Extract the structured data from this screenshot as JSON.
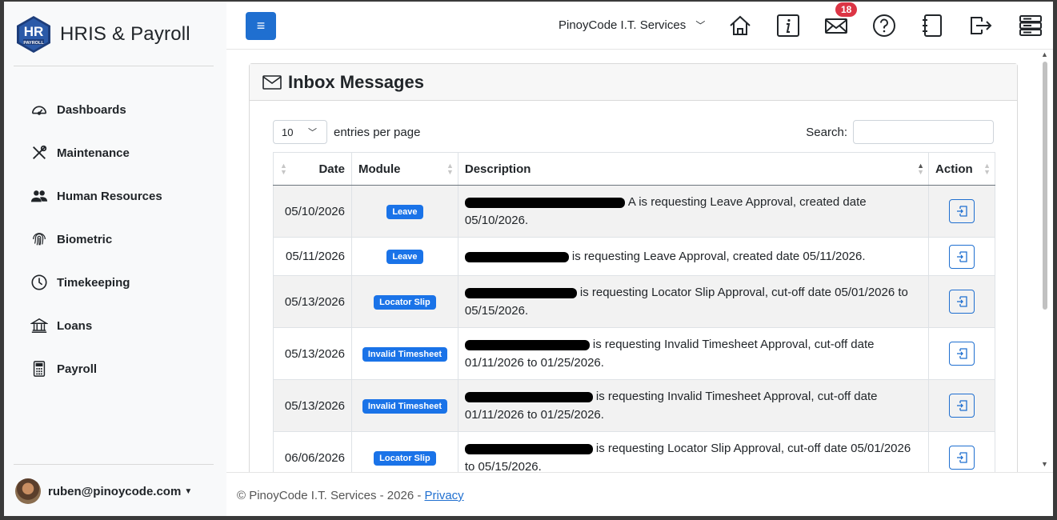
{
  "app": {
    "logo_text": "HR",
    "logo_subtext": "PAYROLL",
    "title": "HRIS & Payroll"
  },
  "sidebar": {
    "items": [
      {
        "label": "Dashboards",
        "icon": "gauge-icon"
      },
      {
        "label": "Maintenance",
        "icon": "tools-icon"
      },
      {
        "label": "Human Resources",
        "icon": "people-icon"
      },
      {
        "label": "Biometric",
        "icon": "fingerprint-icon"
      },
      {
        "label": "Timekeeping",
        "icon": "clock-icon"
      },
      {
        "label": "Loans",
        "icon": "bank-icon"
      },
      {
        "label": "Payroll",
        "icon": "calculator-icon"
      }
    ],
    "user": "ruben@pinoycode.com"
  },
  "topbar": {
    "company": "PinoyCode I.T. Services",
    "notification_count": "18"
  },
  "inbox": {
    "title": "Inbox Messages",
    "page_size": "10",
    "entries_label": "entries per page",
    "search_label": "Search:",
    "search_value": "",
    "columns": {
      "date": "Date",
      "module": "Module",
      "description": "Description",
      "action": "Action"
    },
    "rows": [
      {
        "date": "05/10/2026",
        "module": "Leave",
        "redact_width": 200,
        "text": "A is requesting Leave Approval, created date 05/10/2026."
      },
      {
        "date": "05/11/2026",
        "module": "Leave",
        "redact_width": 130,
        "text": "is requesting Leave Approval, created date 05/11/2026."
      },
      {
        "date": "05/13/2026",
        "module": "Locator Slip",
        "redact_width": 140,
        "text": "is requesting Locator Slip Approval, cut-off date 05/01/2026 to 05/15/2026."
      },
      {
        "date": "05/13/2026",
        "module": "Invalid Timesheet",
        "redact_width": 156,
        "text": "is requesting Invalid Timesheet Approval, cut-off date 01/11/2026 to 01/25/2026."
      },
      {
        "date": "05/13/2026",
        "module": "Invalid Timesheet",
        "redact_width": 160,
        "text": "is requesting Invalid Timesheet Approval, cut-off date 01/11/2026 to 01/25/2026."
      },
      {
        "date": "06/06/2026",
        "module": "Locator Slip",
        "redact_width": 160,
        "text": "is requesting Locator Slip Approval, cut-off date 05/01/2026 to 05/15/2026."
      }
    ]
  },
  "footer": {
    "text": "© PinoyCode I.T. Services - 2026 -",
    "link": "Privacy"
  },
  "colors": {
    "primary": "#1f6fd0",
    "badge": "#dc3545",
    "pill": "#1a73e8"
  }
}
